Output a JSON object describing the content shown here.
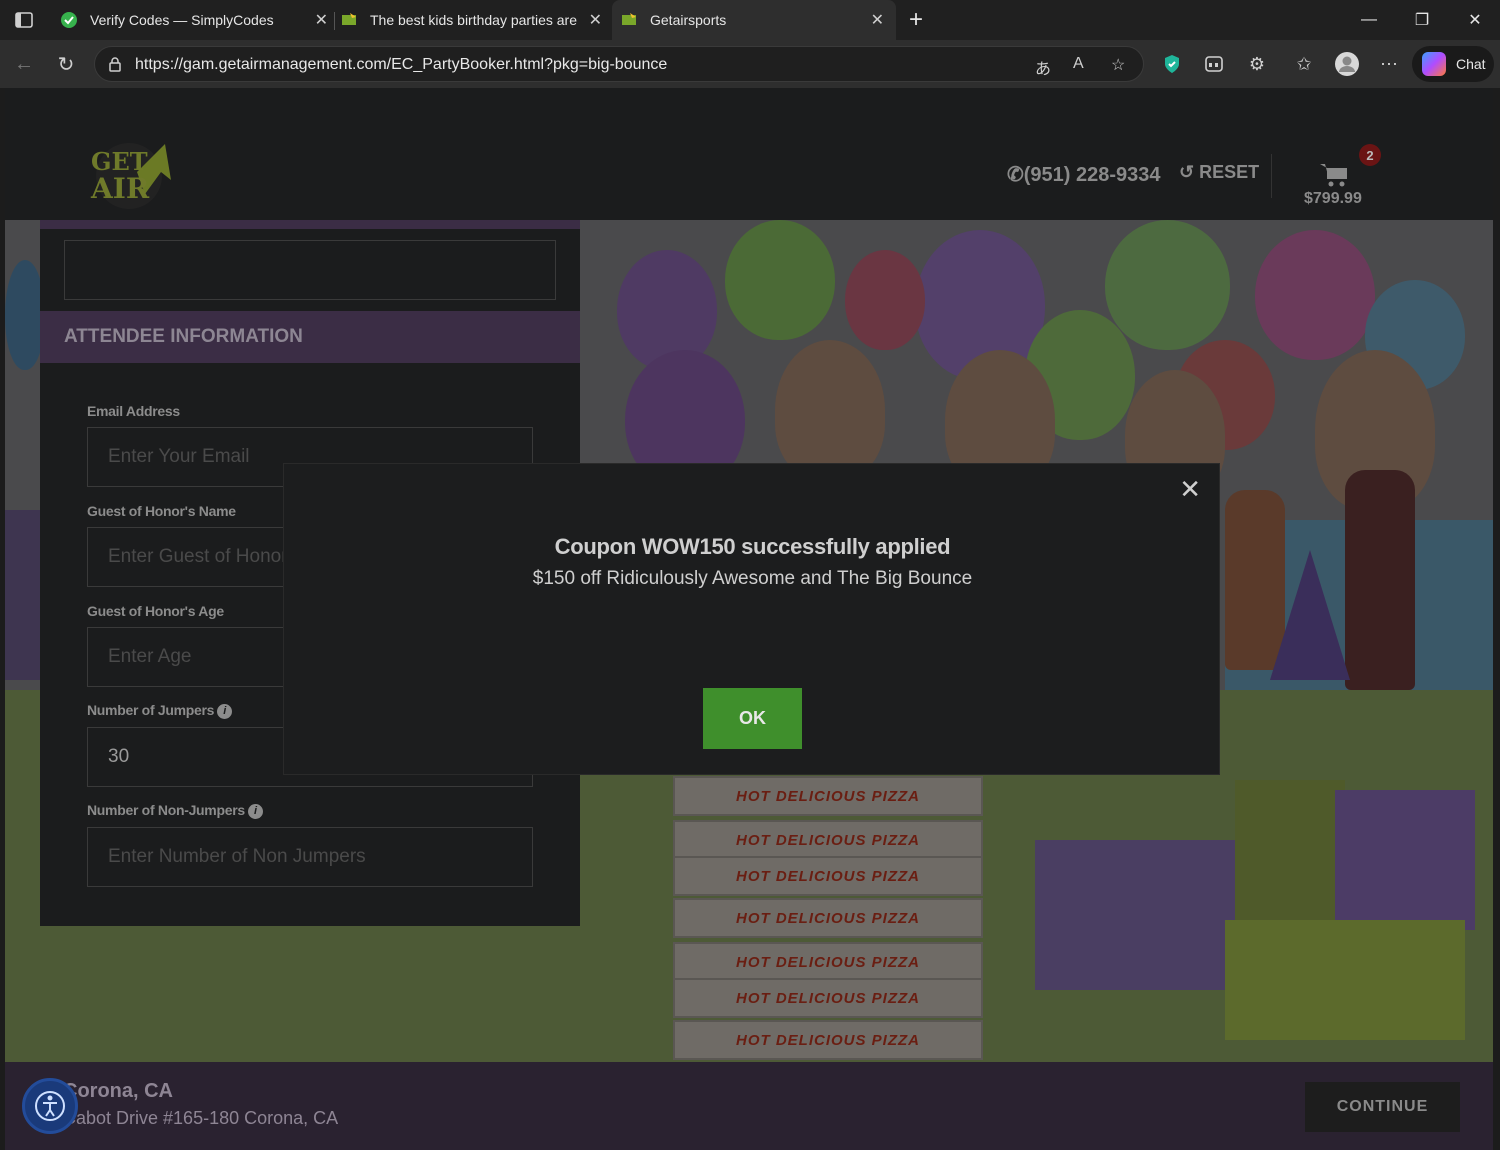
{
  "tabs": [
    {
      "title": "Verify Codes — SimplyCodes",
      "favicon": "simplycodes-icon"
    },
    {
      "title": "The best kids birthday parties are",
      "favicon": "getair-icon"
    },
    {
      "title": "Getairsports",
      "favicon": "getair-icon"
    }
  ],
  "address_bar": {
    "url": "https://gam.getairmanagement.com/EC_PartyBooker.html?pkg=big-bounce"
  },
  "toolbar": {
    "chat_label": "Chat"
  },
  "header": {
    "logo_text_top": "GET",
    "logo_text_bottom": "AIR",
    "phone": "(951) 228-9334",
    "reset_label": "RESET",
    "cart_count": "2",
    "cart_total": "$799.99"
  },
  "form": {
    "section_title": "ATTENDEE INFORMATION",
    "email_label": "Email Address",
    "email_placeholder": "Enter Your Email",
    "guest_name_label": "Guest of Honor's Name",
    "guest_name_placeholder": "Enter Guest of Honor's Name",
    "guest_age_label": "Guest of Honor's Age",
    "guest_age_placeholder": "Enter Age",
    "jumpers_label": "Number of Jumpers",
    "jumpers_value": "30",
    "non_jumpers_label": "Number of Non-Jumpers",
    "non_jumpers_placeholder": "Enter Number of Non Jumpers"
  },
  "hero": {
    "pizza_text": "HOT DELICIOUS PIZZA"
  },
  "footer": {
    "city": "Corona, CA",
    "address": "Cabot Drive #165-180 Corona, CA",
    "continue_label": "CONTINUE"
  },
  "modal": {
    "title": "Coupon WOW150 successfully applied",
    "message": "$150 off Ridiculously Awesome and The Big Bounce",
    "ok_label": "OK"
  },
  "colors": {
    "brand_green": "#3f8f2c",
    "brand_purple": "#3b2d45"
  }
}
